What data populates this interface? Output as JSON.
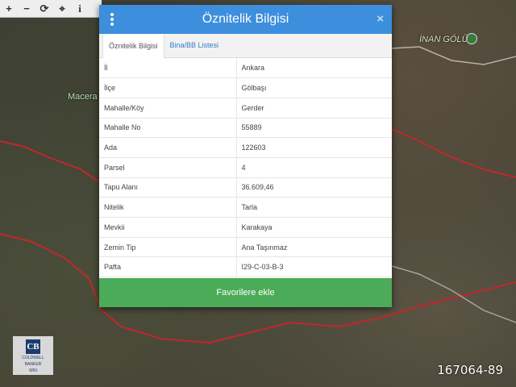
{
  "toolbar": {
    "zoom_in": "+",
    "zoom_out": "−",
    "refresh": "⟳",
    "locate": "⌖",
    "info": "i"
  },
  "map": {
    "labels": {
      "inan": "İNAN GÖLÜ",
      "macera": "Macera P"
    }
  },
  "dialog": {
    "title": "Öznitelik Bilgisi",
    "close": "×",
    "tabs": [
      {
        "label": "Öznitelik Bilgisi",
        "active": true
      },
      {
        "label": "Bina/BB Listesi",
        "active": false
      }
    ],
    "rows": [
      {
        "key": "İl",
        "value": "Ankara"
      },
      {
        "key": "İlçe",
        "value": "Gölbaşı"
      },
      {
        "key": "Mahalle/Köy",
        "value": "Gerder"
      },
      {
        "key": "Mahalle No",
        "value": "55889"
      },
      {
        "key": "Ada",
        "value": "122603"
      },
      {
        "key": "Parsel",
        "value": "4"
      },
      {
        "key": "Tapu Alanı",
        "value": "36.609,46"
      },
      {
        "key": "Nitelik",
        "value": "Tarla"
      },
      {
        "key": "Mevkii",
        "value": "Karakaya"
      },
      {
        "key": "Zemin Tip",
        "value": "Ana Taşınmaz"
      },
      {
        "key": "Pafta",
        "value": "I29-C-03-B-3"
      }
    ],
    "favorite_button": "Favorilere ekle"
  },
  "logo": {
    "mark": "CB",
    "line1": "COLDWELL",
    "line2": "BANKER",
    "line3": "WIN"
  },
  "listing_id": "167064-89",
  "colors": {
    "header": "#3d8edc",
    "favorite": "#4bab58",
    "boundary": "#c0282a"
  }
}
